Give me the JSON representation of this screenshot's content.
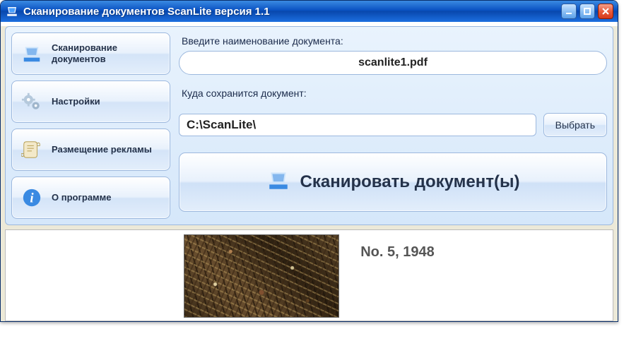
{
  "window": {
    "title": "Сканирование документов ScanLite версия 1.1"
  },
  "sidebar": {
    "items": [
      {
        "label": "Сканирование документов",
        "icon": "scanner-icon"
      },
      {
        "label": "Настройки",
        "icon": "gears-icon"
      },
      {
        "label": "Размещение рекламы",
        "icon": "scroll-icon"
      },
      {
        "label": "О программе",
        "icon": "info-icon"
      }
    ]
  },
  "form": {
    "filename_label": "Введите наименование документа:",
    "filename_value": "scanlite1.pdf",
    "path_label": "Куда сохранится документ:",
    "path_value": "C:\\ScanLite\\",
    "browse_label": "Выбрать"
  },
  "scan_button": {
    "label": "Сканировать документ(ы)"
  },
  "preview": {
    "caption": "No. 5, 1948"
  }
}
